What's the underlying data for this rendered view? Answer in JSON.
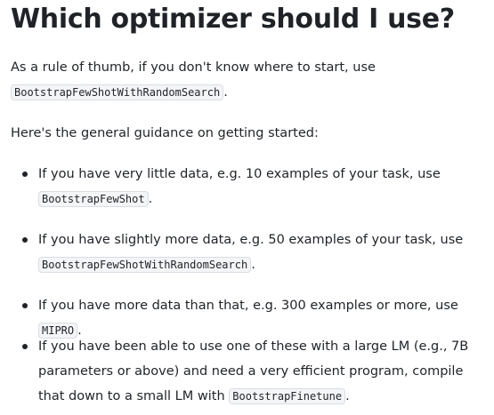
{
  "heading": "Which optimizer should I use?",
  "intro": {
    "text": "As a rule of thumb, if you don't know where to start, use",
    "code": "BootstrapFewShotWithRandomSearch",
    "end": "."
  },
  "guidance_intro": "Here's the general guidance on getting started:",
  "items": [
    {
      "text": "If you have very little data, e.g. 10 examples of your task, use",
      "code": "BootstrapFewShot",
      "end": "."
    },
    {
      "text": "If you have slightly more data, e.g. 50 examples of your task, use",
      "code": "BootstrapFewShotWithRandomSearch",
      "end": "."
    },
    {
      "text": "If you have more data than that, e.g. 300 examples or more, use",
      "code": "MIPRO",
      "end": "."
    },
    {
      "text": "If you have been able to use one of these with a large LM (e.g., 7B parameters or above) and need a very efficient program, compile that down to a small LM with",
      "code": "BootstrapFinetune",
      "end": "."
    }
  ]
}
